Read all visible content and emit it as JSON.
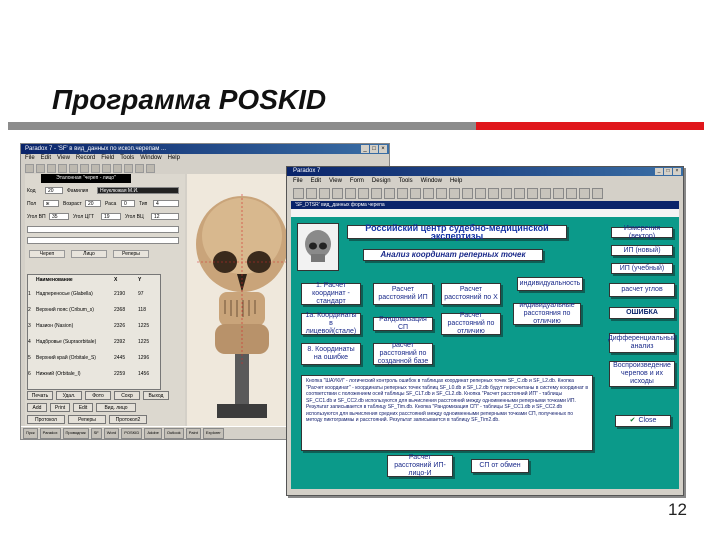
{
  "slide": {
    "title": "Программа POSKID",
    "number": "12",
    "accent_grey": "#8c8c8c",
    "accent_red": "#e0161b"
  },
  "window1": {
    "title": "Paradox 7 - 'SF' в вид_данных по ископ.черепам ...",
    "controls": [
      "_",
      "□",
      "×"
    ],
    "menu": [
      "File",
      "Edit",
      "View",
      "Record",
      "Field",
      "Tools",
      "Window",
      "Help"
    ],
    "form_header": "Эталонная \"череп - лицо\"",
    "fields": [
      {
        "label": "Код",
        "value": "20"
      },
      {
        "label": "Фамилия",
        "value": "Неуклюжая М.И."
      },
      {
        "label": "Пол",
        "value": "ж"
      },
      {
        "label": "Возраст",
        "value": "20"
      },
      {
        "label": "Раса",
        "value": "0"
      },
      {
        "label": "Тип",
        "value": "4"
      },
      {
        "label": "Угол ВП",
        "value": "35"
      },
      {
        "label": "Угол ЦГТ",
        "value": "19"
      },
      {
        "label": "Угол ВЦ",
        "value": "12"
      }
    ],
    "tabs": [
      "Череп",
      "Лицо",
      "Реперы"
    ],
    "table_headers": [
      "Наименование",
      "X",
      "Y"
    ],
    "table_rows": [
      {
        "num": "1",
        "name": "Надпереносье (Glabella)",
        "x": "2190",
        "y": "97"
      },
      {
        "num": "2",
        "name": "Верхний пояс (Cribum_s)",
        "x": "2368",
        "y": "118"
      },
      {
        "num": "3",
        "name": "Назион (Nasion)",
        "x": "2326",
        "y": "1225"
      },
      {
        "num": "4",
        "name": "Надбровье (Supraorbitale)",
        "x": "2392",
        "y": "1225"
      },
      {
        "num": "5",
        "name": "Верхний край (Orbitale_S)",
        "x": "2445",
        "y": "1296"
      },
      {
        "num": "6",
        "name": "Нижний (Orbitale_I)",
        "x": "2259",
        "y": "1456"
      }
    ],
    "buttons_row1": [
      "Печать",
      "Удал.",
      "Фото",
      "Сохр",
      "Выход"
    ],
    "buttons_row2": [
      "Add",
      "Print",
      "Edit",
      "Вид. лицо"
    ],
    "buttons_row3": [
      "Протокол",
      "Реперы",
      "Протокол2"
    ],
    "taskbar": [
      "Пуск",
      "Paradox",
      "Проводник",
      "SF",
      "Word",
      "POSKID",
      "Adobe",
      "Outlook",
      "Paint",
      "Explorer"
    ]
  },
  "window2": {
    "title": "Paradox 7",
    "controls": [
      "_",
      "□",
      "×"
    ],
    "menu": [
      "File",
      "Edit",
      "View",
      "Form",
      "Design",
      "Tools",
      "Window",
      "Help"
    ],
    "subtitle": "'SF_DTSR' вид_данных форма черепа",
    "header_text": "Российский центр судебно-медицинской экспертизы",
    "section_title": "Анализ координат реперных точек",
    "buttons": {
      "b1": "1. Расчет координат - стандарт",
      "b2": "Расчет расстояний ИП",
      "b3": "Расчет расстояний по X",
      "b4": "1а. Координаты в лицевой(стале)",
      "b5": "Рандомизация СП",
      "b6": "Расчет расстояний по отличию",
      "b7": "8. Координаты на ошибке",
      "b8": "расчет расстояний по созданной базе",
      "r1": "индивидуальность",
      "r2": "индивидуальные расстояния по отличию",
      "far1": "Измерения (вектор)",
      "far2": "ИП (новый)",
      "far3": "ИП (учебный)",
      "far4": "расчет углов",
      "far5": "ОШИБКА",
      "far6": "Дифференциальный анализ",
      "far7": "Воспроизведение черепов и их исходы",
      "close": "Close",
      "bot1": "Расчет расстояний ИП-лицо-И",
      "bot2": "СП от обмен"
    },
    "description": "Кнопка \"ШАУКИ\" - логический контроль ошибок в таблицах координат реперных точек SF_C.db и SF_L2.db. Кнопка \"Расчет координат\" - координаты реперных точек таблиц SF_L0.db и SF_L2.db будут пересчитаны в систему координат в соответствии с положением осей таблицы SF_CLT.db и SF_CL2.db. Кнопка \"Расчет расстояний ИП\" - таблицы SF_CC1.db и SF_CC2.db используются для вычисления расстояний между одноименными реперными точками ИП. Результат записывается в таблицу SF_Tim.db. Кнопка \"Рандомизация СП\" - таблицы SF_CC1.db и SF_CC2.db используются для вычисления средних расстояний между одноименными реперными точками СП, полученных по методу пиктограммы и расстояний. Результат записывается в таблицу SF_Tim2.db."
  }
}
